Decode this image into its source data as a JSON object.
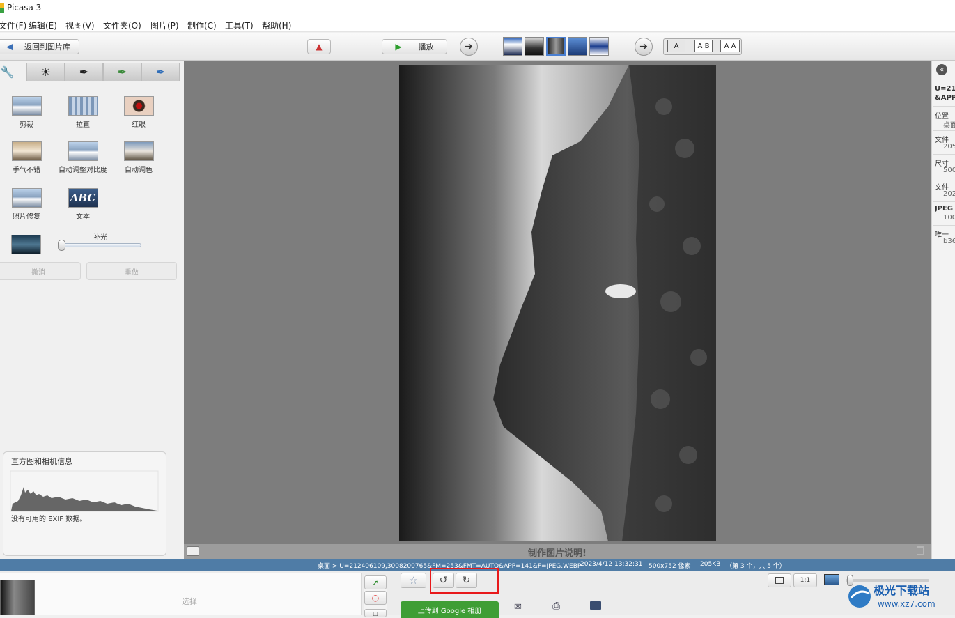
{
  "window": {
    "title": "Picasa 3"
  },
  "menu": [
    "文件(F)",
    "编辑(E)",
    "视图(V)",
    "文件夹(O)",
    "图片(P)",
    "制作(C)",
    "工具(T)",
    "帮助(H)"
  ],
  "toolbar": {
    "back_label": "返回到图片库",
    "play_label": "播放",
    "text_modes": [
      "A",
      "A B",
      "A A"
    ]
  },
  "edit_tabs": [
    "wrench-icon",
    "sun-icon",
    "brush-icon",
    "brush-green-icon",
    "brush-blue-icon"
  ],
  "tools": {
    "crop": "剪裁",
    "straighten": "拉直",
    "red_eye": "红眼",
    "lucky": "手气不错",
    "auto_contrast": "自动调整对比度",
    "auto_color": "自动调色",
    "retouch": "照片修复",
    "text": "文本",
    "text_icon": "ABC",
    "fill_light_label": "补光",
    "fill_light_value": 0.0,
    "undo": "撤消",
    "redo": "重做"
  },
  "histogram": {
    "title": "直方图和相机信息",
    "no_exif": "没有可用的 EXIF 数据。"
  },
  "caption": "制作图片说明!",
  "right_panel": {
    "name": "U=21",
    "name2": "&APP",
    "location_label": "位置",
    "location_value": "桌面",
    "filesize_label": "文件",
    "filesize_value": "205",
    "dimensions_label": "尺寸",
    "dimensions_value": "500",
    "date_label": "文件",
    "date_value": "202",
    "format_label": "JPEG",
    "format_value": "100",
    "unique_label": "唯一",
    "unique_value": "b36"
  },
  "status": {
    "path": "桌面 > U=212406109,3008200765&FM=253&FMT=AUTO&APP=141&F=JPEG.WEBP",
    "date": "2023/4/12 13:32:31",
    "dimensions": "500x752 像素",
    "size": "205KB",
    "position": "（第 3 个，共 5 个）"
  },
  "tray": {
    "select_label": "选择"
  },
  "actions": {
    "upload_label": "上传到 Google 相册",
    "zoom_fit": "1:1"
  },
  "colors": {
    "status_bar": "#4f7ca6",
    "upload_green": "#3f9e35",
    "highlight_red": "#e8191b",
    "viewer_bg": "#7d7d7d"
  }
}
